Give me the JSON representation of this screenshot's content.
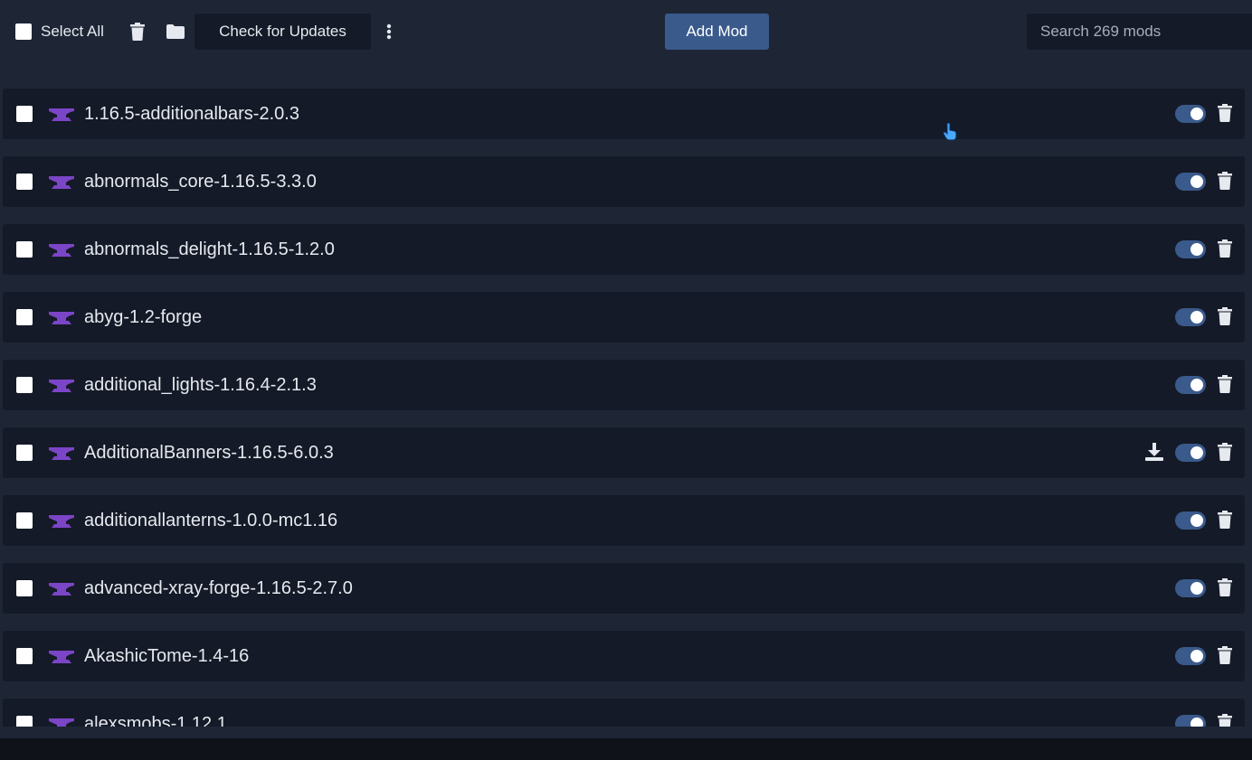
{
  "toolbar": {
    "select_all_label": "Select All",
    "check_updates_label": "Check for Updates",
    "add_mod_label": "Add Mod",
    "search_placeholder": "Search 269 mods"
  },
  "mods": [
    {
      "name": "1.16.5-additionalbars-2.0.3",
      "enabled": true,
      "update_available": false
    },
    {
      "name": "abnormals_core-1.16.5-3.3.0",
      "enabled": true,
      "update_available": false
    },
    {
      "name": "abnormals_delight-1.16.5-1.2.0",
      "enabled": true,
      "update_available": false
    },
    {
      "name": "abyg-1.2-forge",
      "enabled": true,
      "update_available": false
    },
    {
      "name": "additional_lights-1.16.4-2.1.3",
      "enabled": true,
      "update_available": false
    },
    {
      "name": "AdditionalBanners-1.16.5-6.0.3",
      "enabled": true,
      "update_available": true
    },
    {
      "name": "additionallanterns-1.0.0-mc1.16",
      "enabled": true,
      "update_available": false
    },
    {
      "name": "advanced-xray-forge-1.16.5-2.7.0",
      "enabled": true,
      "update_available": false
    },
    {
      "name": "AkashicTome-1.4-16",
      "enabled": true,
      "update_available": false
    },
    {
      "name": "alexsmobs-1.12.1",
      "enabled": true,
      "update_available": false
    }
  ],
  "colors": {
    "background": "#1e2636",
    "row": "#141a27",
    "accent": "#3a5a8c",
    "forge_icon": "#7b45c7"
  }
}
